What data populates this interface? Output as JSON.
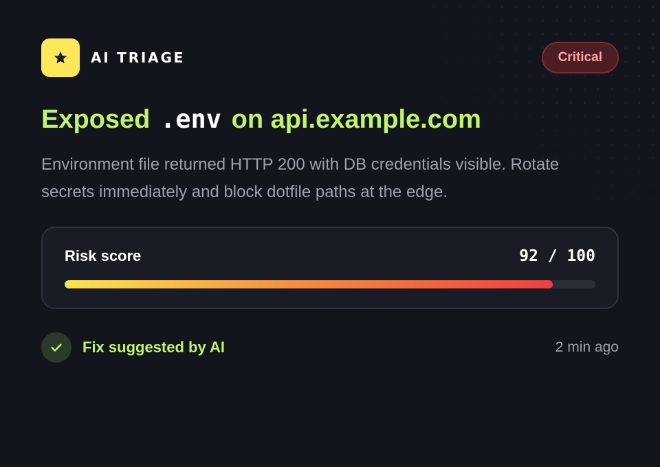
{
  "brand": {
    "label": "AI TRIAGE",
    "icon": "star-icon",
    "icon_bg_color": "#fce85a"
  },
  "badge": {
    "label": "Critical",
    "color": "#ffa3a6"
  },
  "title": {
    "prefix": "Exposed",
    "code": ".env",
    "suffix": "on api.example.com",
    "color": "#c0f36e"
  },
  "description": "Environment file returned HTTP 200 with DB credentials visible. Rotate secrets immediately and block dotfile paths at the edge.",
  "risk": {
    "label": "Risk score",
    "value_text": "92 / 100",
    "score": 92,
    "max": 100,
    "bar_colors": [
      "#fbe54f",
      "#f5913f",
      "#ef3e3e"
    ]
  },
  "footer": {
    "fix_label": "Fix suggested by AI",
    "fix_icon": "check-icon",
    "timestamp": "2 min ago"
  }
}
